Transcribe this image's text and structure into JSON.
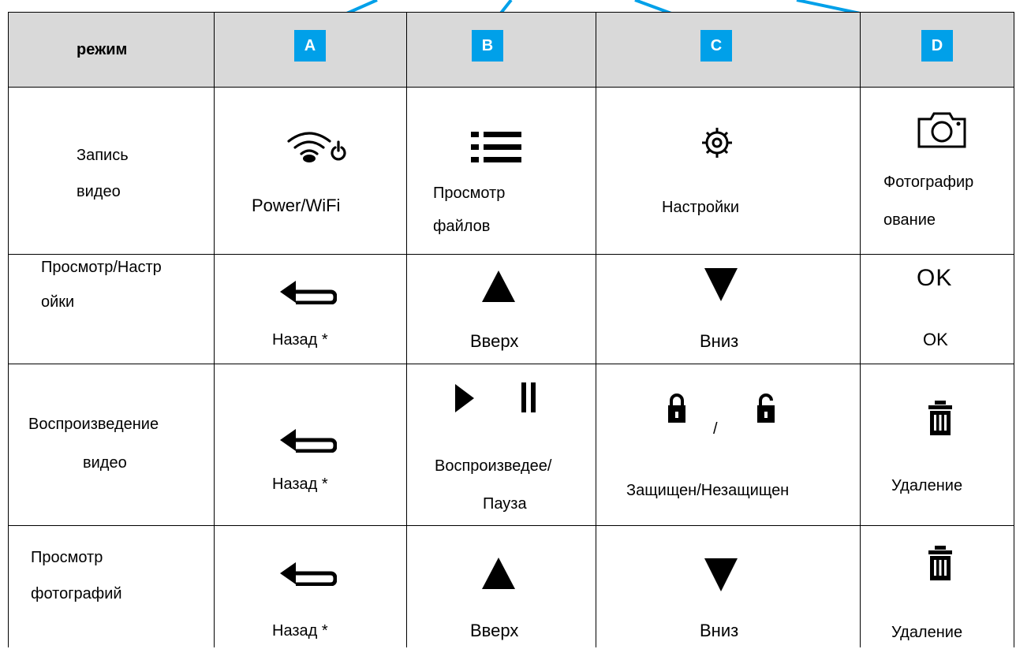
{
  "header": {
    "mode_label": "режим",
    "badges": [
      "A",
      "B",
      "C",
      "D"
    ],
    "badge_color": "#00a0e9",
    "header_bg": "#d9d9d9"
  },
  "rows": [
    {
      "mode_lines": [
        "Запись",
        "видео"
      ],
      "cells": [
        {
          "icon": "wifi-power-icon",
          "lines": [
            "Power/WiFi"
          ]
        },
        {
          "icon": "list-icon",
          "lines": [
            "Просмотр",
            "файлов"
          ]
        },
        {
          "icon": "gear-icon",
          "lines": [
            "Настройки"
          ]
        },
        {
          "icon": "camera-icon",
          "lines": [
            "Фотографир",
            "ование"
          ]
        }
      ]
    },
    {
      "mode_lines": [
        "Просмотр/Настр",
        "ойки"
      ],
      "cells": [
        {
          "icon": "back-arrow-icon",
          "lines": [
            "Назад *"
          ]
        },
        {
          "icon": "triangle-up-icon",
          "lines": [
            "Вверх"
          ]
        },
        {
          "icon": "triangle-down-icon",
          "lines": [
            "Вниз"
          ]
        },
        {
          "icon": "ok-icon",
          "icon_text": "OK",
          "lines": [
            "OK"
          ]
        }
      ]
    },
    {
      "mode_lines": [
        "Воспроизведение",
        "видео"
      ],
      "cells": [
        {
          "icon": "back-arrow-icon",
          "lines": [
            "Назад *"
          ]
        },
        {
          "icon": "play-pause-icon",
          "lines": [
            "Воспроизведее/",
            "Пауза"
          ]
        },
        {
          "icon": "lock-unlock-icon",
          "separator": "/",
          "lines": [
            "Защищен/Незащищен"
          ]
        },
        {
          "icon": "trash-icon",
          "lines": [
            "Удаление"
          ]
        }
      ]
    },
    {
      "mode_lines": [
        "Просмотр",
        "фотографий"
      ],
      "cells": [
        {
          "icon": "back-arrow-icon",
          "lines": [
            "Назад *"
          ]
        },
        {
          "icon": "triangle-up-icon",
          "lines": [
            "Вверх"
          ]
        },
        {
          "icon": "triangle-down-icon",
          "lines": [
            "Вниз"
          ]
        },
        {
          "icon": "trash-icon",
          "lines": [
            "Удаление"
          ]
        }
      ]
    }
  ]
}
